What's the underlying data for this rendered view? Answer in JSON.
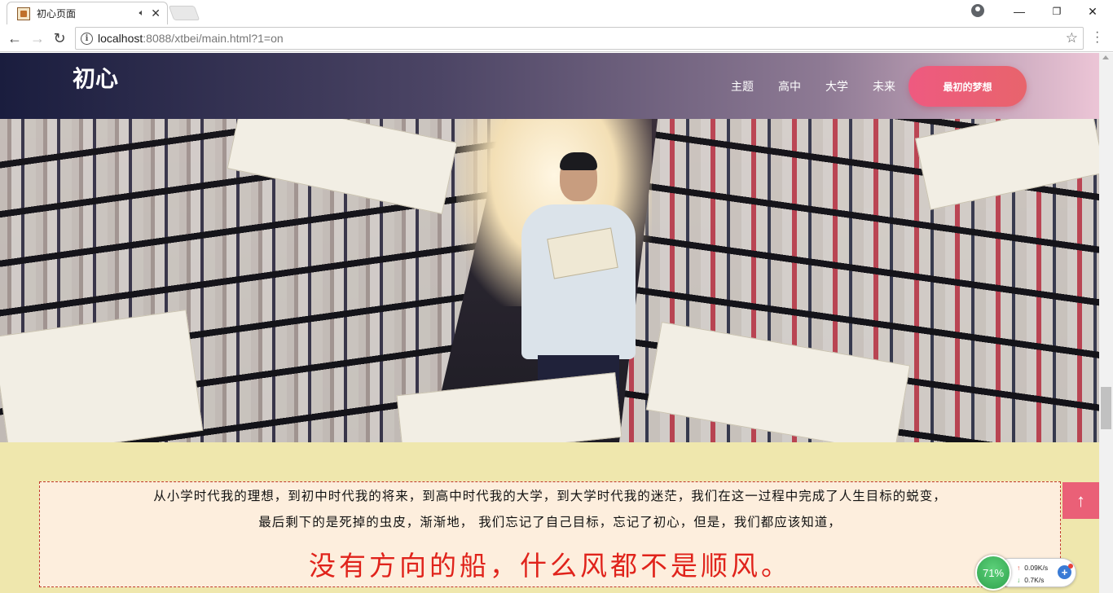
{
  "browser": {
    "tab_title": "初心页面",
    "tab_audio_icon": "speaker-icon",
    "tab_close": "✕",
    "url_host": "localhost",
    "url_rest": ":8088/xtbei/main.html?1=on",
    "win_minimize": "—",
    "win_maximize": "❐",
    "win_close": "✕"
  },
  "site": {
    "logo": "初心",
    "nav": [
      "主题",
      "高中",
      "大学",
      "未来"
    ],
    "cta_label": "最初的梦想"
  },
  "hero": {
    "image_icon": "library-photo"
  },
  "quote": {
    "line1": "从小学时代我的理想，到初中时代我的将来，到高中时代我的大学，到大学时代我的迷茫，我们在这一过程中完成了人生目标的蜕变，",
    "line2": "最后剩下的是死掉的虫皮，渐渐地， 我们忘记了自己目标，忘记了初心，但是，我们都应该知道，",
    "big": "没有方向的船，什么风都不是顺风。",
    "big_color": "#e0231b"
  },
  "back_to_top": "↑",
  "net_widget": {
    "percent": "71%",
    "upload": "0.09K/s",
    "download": "0.7K/s",
    "plus": "+"
  },
  "colors": {
    "header_gradient_start": "#1a1d3e",
    "header_gradient_end": "#ecc5d6",
    "cta": "#ee5a80",
    "page_bg": "#efe7ad",
    "quote_bg": "#fdeedd"
  }
}
